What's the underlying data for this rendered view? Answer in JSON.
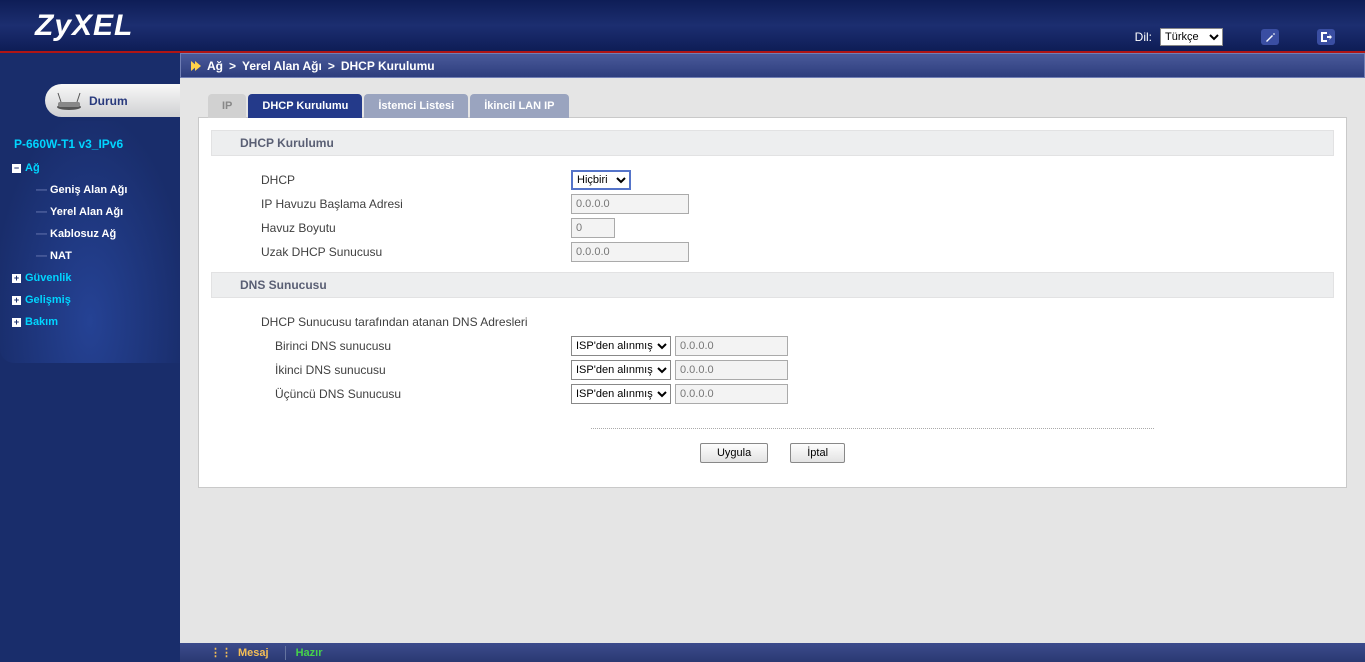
{
  "header": {
    "logo": "ZyXEL",
    "lang_label": "Dil:",
    "lang_value": "Türkçe"
  },
  "breadcrumb": {
    "p1": "Ağ",
    "p2": "Yerel Alan Ağı",
    "p3": "DHCP Kurulumu"
  },
  "sidebar": {
    "durum": "Durum",
    "model": "P-660W-T1 v3_IPv6",
    "ag": "Ağ",
    "ag_items": {
      "genis": "Geniş Alan Ağı",
      "yerel": "Yerel Alan Ağı",
      "kablosuz": "Kablosuz Ağ",
      "nat": "NAT"
    },
    "guvenlik": "Güvenlik",
    "gelismis": "Gelişmiş",
    "bakim": "Bakım"
  },
  "tabs": {
    "ip": "IP",
    "dhcp": "DHCP Kurulumu",
    "istemci": "İstemci Listesi",
    "ikincil": "İkincil LAN IP"
  },
  "section1": {
    "title": "DHCP Kurulumu",
    "dhcp_label": "DHCP",
    "dhcp_value": "Hiçbiri",
    "pool_start_label": "IP Havuzu Başlama Adresi",
    "pool_start_value": "0.0.0.0",
    "pool_size_label": "Havuz Boyutu",
    "pool_size_value": "0",
    "remote_label": "Uzak DHCP Sunucusu",
    "remote_value": "0.0.0.0"
  },
  "section2": {
    "title": "DNS Sunucusu",
    "assigned_label": "DHCP Sunucusu tarafından atanan DNS Adresleri",
    "dns1_label": "Birinci DNS sunucusu",
    "dns2_label": "İkinci DNS sunucusu",
    "dns3_label": "Üçüncü DNS Sunucusu",
    "source_option": "ISP'den alınmış",
    "dns_value": "0.0.0.0"
  },
  "buttons": {
    "apply": "Uygula",
    "cancel": "İptal"
  },
  "statusbar": {
    "label": "Mesaj",
    "status": "Hazır"
  }
}
